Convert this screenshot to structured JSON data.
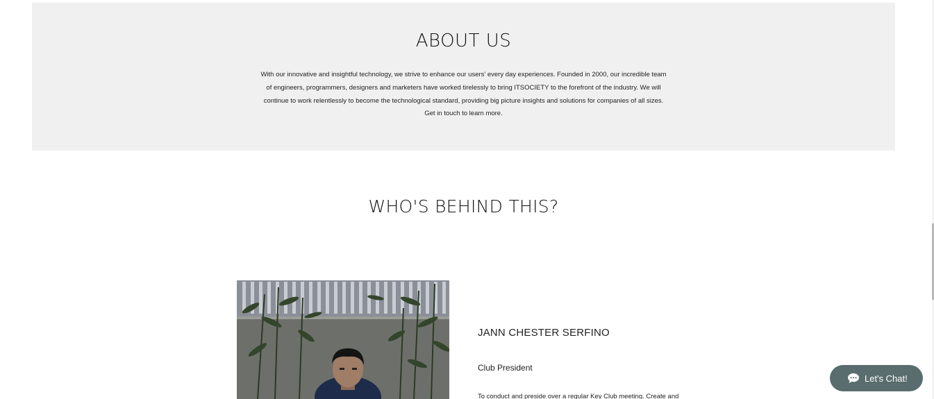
{
  "about": {
    "title": "ABOUT US",
    "lines": [
      "With our innovative and insightful technology, we strive to enhance our users' every day experiences. Founded in 2000, our incredible team",
      "of engineers, programmers, designers and marketers have worked tirelessly to bring ITSOCIETY to the forefront of the industry. We will",
      "continue to work relentlessly to become the technological standard, providing big picture insights and solutions for companies of all sizes.",
      "Get in touch to learn more."
    ]
  },
  "team": {
    "title": "WHO'S BEHIND THIS?",
    "members": [
      {
        "name": "JANN CHESTER SERFINO",
        "role": "Club President",
        "description": "To conduct and preside over a regular Key Club meeting. Create and"
      }
    ]
  },
  "chat": {
    "label": "Let's Chat!",
    "icon": "chat-bubble-icon"
  },
  "colors": {
    "about_background": "#f0f0f0",
    "chat_button": "#5a6d6e"
  }
}
